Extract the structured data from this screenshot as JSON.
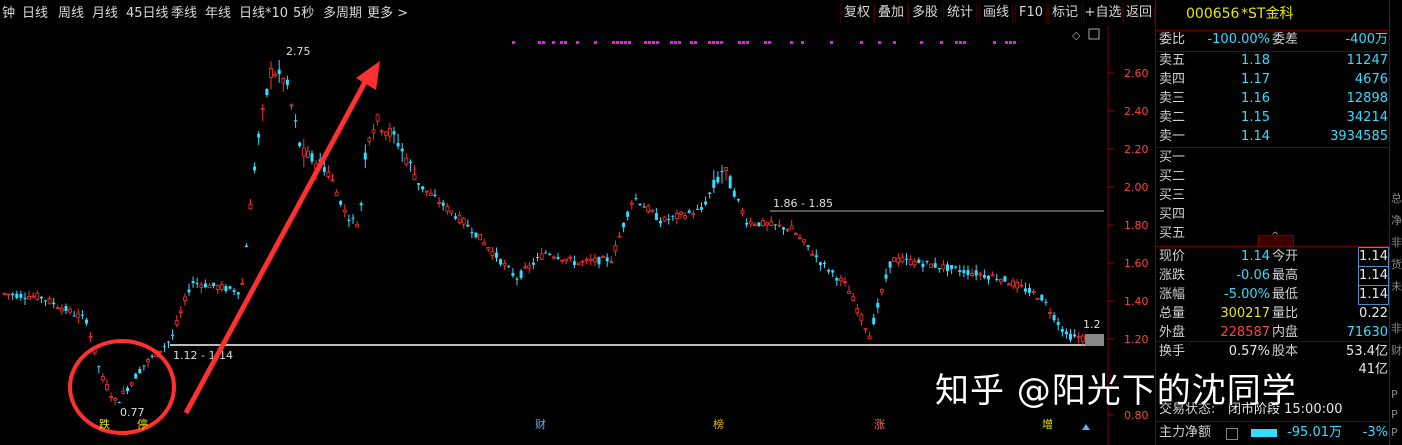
{
  "toolbar": {
    "period_tabs": [
      "钟",
      "日线",
      "周线",
      "月线",
      "45日线",
      "季线",
      "年线",
      "日线*10",
      "5秒",
      "多周期",
      "更多 >"
    ],
    "buttons": [
      "复权",
      "叠加",
      "多股",
      "统计",
      "画线",
      "F10",
      "标记",
      "+自选",
      "返回"
    ]
  },
  "chart": {
    "price_ticks": [
      "2.60",
      "2.40",
      "2.20",
      "2.00",
      "1.80",
      "1.60",
      "1.40",
      "1.20",
      "0.80"
    ],
    "annotations": {
      "high": "2.75",
      "low": "0.77",
      "mid_label": "1.86 - 1.85",
      "support_label": "1.12 - 1.14",
      "last_label": "1.2"
    },
    "event_markers": [
      "跌",
      "停",
      "财",
      "榜",
      "涨",
      "增"
    ],
    "colors": {
      "up": "#ff3030",
      "down": "#33ddff",
      "arrow": "#ff3030",
      "line": "#bbbbbb",
      "signal": "#dd22dd"
    }
  },
  "panel": {
    "code": "000656",
    "name": "*ST金科",
    "weibi_label": "委比",
    "weibi_value": "-100.00%",
    "weicha_label": "委差",
    "weicha_value": "-400万",
    "asks": [
      {
        "label": "卖五",
        "price": "1.18",
        "vol": "11247"
      },
      {
        "label": "卖四",
        "price": "1.17",
        "vol": "4676"
      },
      {
        "label": "卖三",
        "price": "1.16",
        "vol": "12898"
      },
      {
        "label": "卖二",
        "price": "1.15",
        "vol": "34214"
      },
      {
        "label": "卖一",
        "price": "1.14",
        "vol": "3934585"
      }
    ],
    "bids": [
      "买一",
      "买二",
      "买三",
      "买四",
      "买五"
    ],
    "stats": [
      {
        "l1": "现价",
        "v1": "1.14",
        "l2": "今开",
        "v2": "1.14"
      },
      {
        "l1": "涨跌",
        "v1": "-0.06",
        "l2": "最高",
        "v2": "1.14"
      },
      {
        "l1": "涨幅",
        "v1": "-5.00%",
        "l2": "最低",
        "v2": "1.14"
      },
      {
        "l1": "总量",
        "v1": "300217",
        "l2": "量比",
        "v2": "0.22"
      },
      {
        "l1": "外盘",
        "v1": "228587",
        "l2": "内盘",
        "v2": "71630"
      }
    ],
    "turnover_label": "换手",
    "turnover": "0.57%",
    "share_label": "股本",
    "share": "53.4亿",
    "extra_value": "41亿",
    "trade_status_label": "交易状态:",
    "trade_status": "闭市阶段 15:00:00",
    "main_flow_label": "主力净额",
    "main_flow": "-95.01万",
    "main_flow_pct": "-3%"
  },
  "watermark": "知乎 @阳光下的沈同学",
  "edge_chars": [
    "总",
    "净",
    "非",
    "货",
    "未",
    "非",
    "财",
    "P",
    "P",
    "P"
  ]
}
